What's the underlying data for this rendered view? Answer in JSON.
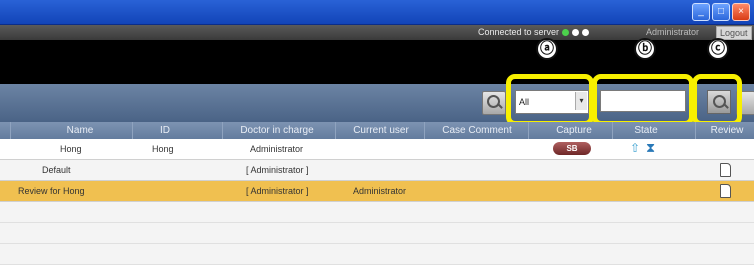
{
  "window": {
    "minimize_label": "_",
    "maximize_label": "□",
    "close_label": "×"
  },
  "status": {
    "connection_text": "Connected to server",
    "user": "Administrator",
    "logout_label": "Logout",
    "dot_colors": [
      "#4cd14c",
      "#ffffff",
      "#ffffff"
    ]
  },
  "toolbar": {
    "filter_value": "All",
    "filter_arrow": "▾",
    "search_value": "",
    "search_placeholder": ""
  },
  "annotations": {
    "a": "ⓐ",
    "b": "ⓑ",
    "c": "ⓒ"
  },
  "table": {
    "columns": [
      "Name",
      "ID",
      "Doctor in charge",
      "Current user",
      "Case Comment",
      "Capture",
      "State",
      "Review"
    ],
    "rows": [
      {
        "name": "Hong",
        "id": "Hong",
        "doctor": "Administrator",
        "current_user": "",
        "capture_badge": "SB",
        "state_icons": [
          "⇧",
          "⧗"
        ],
        "highlight": false
      },
      {
        "name": "Default",
        "id": "",
        "doctor": "[ Administrator ]",
        "current_user": "",
        "highlight": false
      },
      {
        "name": "Review for Hong",
        "id": "",
        "doctor": "[ Administrator ]",
        "current_user": "Administrator",
        "highlight": true
      }
    ]
  },
  "colors": {
    "highlight": "#f8f000",
    "selected_row": "#f0c050",
    "toolbar": "#5a7294"
  }
}
